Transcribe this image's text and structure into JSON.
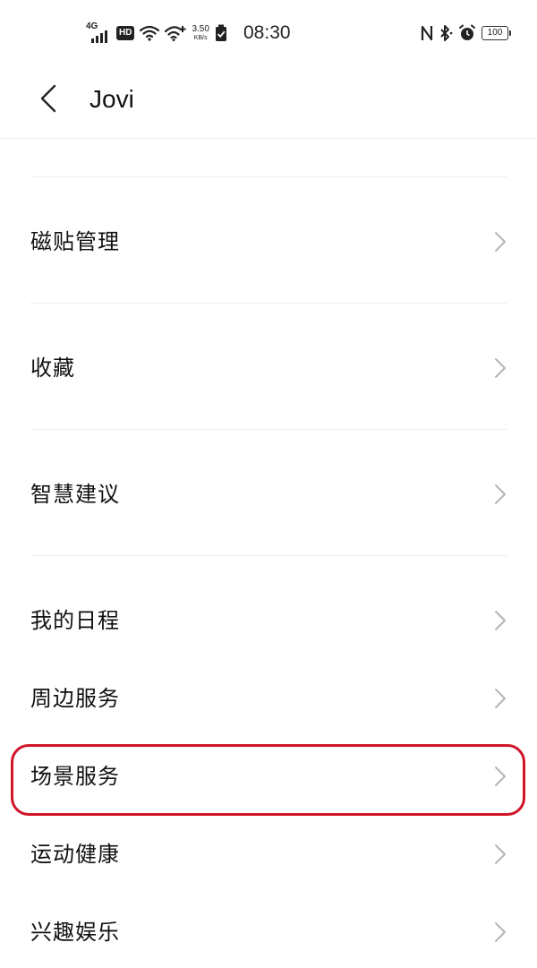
{
  "status_bar": {
    "network": "4G",
    "hd": "HD",
    "speed_value": "3.50",
    "speed_unit": "KB/s",
    "time": "08:30",
    "battery": "100",
    "icons": [
      "signal-icon",
      "wifi-icon",
      "wifi-plus-icon",
      "sim-check-icon",
      "nfc-icon",
      "bluetooth-icon",
      "alarm-icon",
      "battery-icon"
    ]
  },
  "header": {
    "title": "Jovi",
    "back_icon": "chevron-left-icon"
  },
  "menu": {
    "items": [
      {
        "label": "磁贴管理"
      },
      {
        "label": "收藏"
      },
      {
        "label": "智慧建议"
      },
      {
        "label": "我的日程"
      },
      {
        "label": "周边服务"
      },
      {
        "label": "场景服务",
        "highlighted": true
      },
      {
        "label": "运动健康"
      },
      {
        "label": "兴趣娱乐"
      }
    ],
    "chevron_icon": "chevron-right-icon"
  },
  "colors": {
    "highlight": "#d21428",
    "divider": "#ececec",
    "chevron": "#b5b5b5",
    "text": "#111111"
  }
}
